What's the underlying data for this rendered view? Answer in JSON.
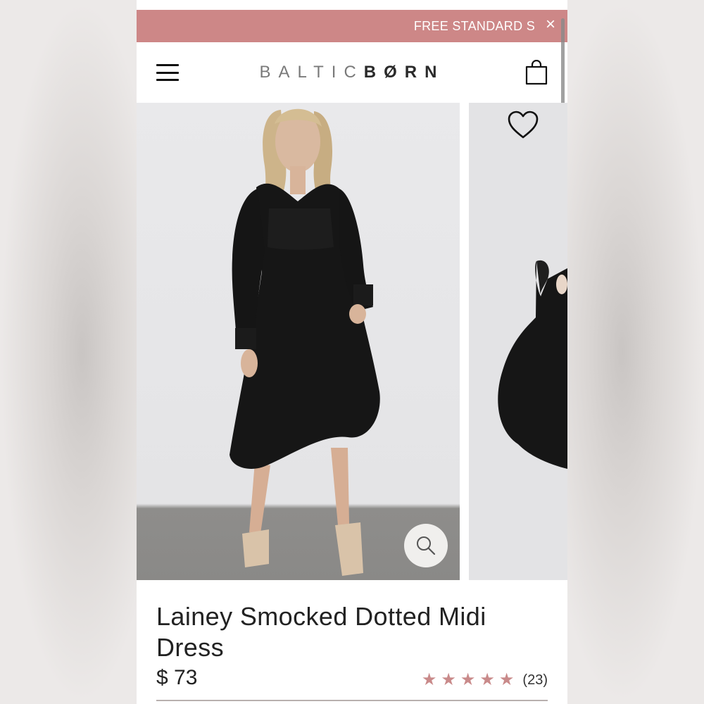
{
  "promo": {
    "text": "FREE STANDARD S",
    "close_label": "×"
  },
  "header": {
    "menu_icon": "hamburger-menu-icon",
    "logo_left": "BALTIC",
    "logo_right": "BØRN",
    "cart_icon": "shopping-bag-icon"
  },
  "gallery": {
    "wishlist_icon": "heart-icon",
    "zoom_icon": "magnifier-icon"
  },
  "product": {
    "title": "Lainey Smocked Dotted Midi Dress",
    "price": "$ 73",
    "rating": 5,
    "rating_max": 5,
    "review_count": "(23)"
  },
  "colors": {
    "promo_bg": "#cd8787",
    "star": "#c98a8a",
    "dress": "#161616"
  }
}
